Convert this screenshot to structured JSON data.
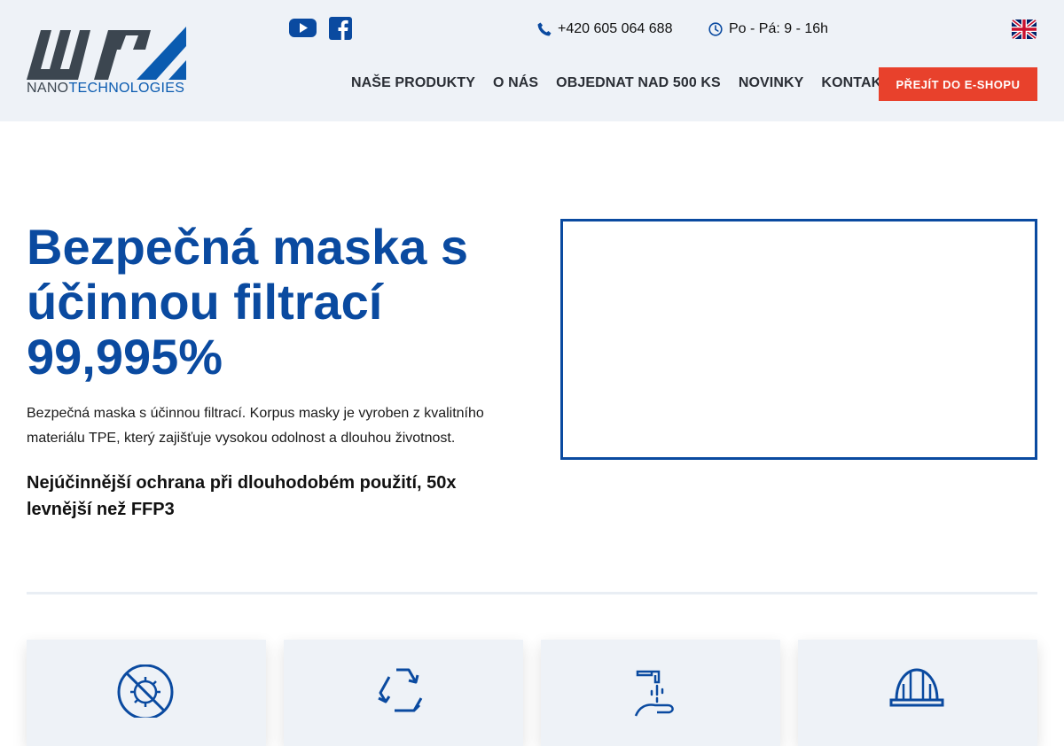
{
  "header": {
    "logo_word_left": "NANO",
    "logo_word_right": "TECHNOLOGIES",
    "phone": "+420 605 064 688",
    "hours": "Po - Pá: 9 - 16h",
    "nav": [
      "NAŠE PRODUKTY",
      "O NÁS",
      "OBJEDNAT NAD 500 KS",
      "NOVINKY",
      "KONTAKTY"
    ],
    "shop_button": "PŘEJÍT DO E-SHOPU"
  },
  "hero": {
    "title": "Bezpečná maska s účinnou filtrací 99,995%",
    "description": "Bezpečná maska s účinnou filtrací. Korpus masky je vyroben z kvalitního materiálu TPE, který zajišťuje vysokou odolnost a dlouhou životnost.",
    "highlight": "Nejúčinnější ochrana při dlouhodobém použití, 50x levnější než FFP3"
  },
  "colors": {
    "primary": "#0a4aa0",
    "accent": "#e8412c",
    "header_bg": "#eef2f7"
  },
  "icons": [
    "youtube-icon",
    "facebook-icon",
    "phone-icon",
    "clock-icon",
    "uk-flag-icon",
    "no-virus-icon",
    "recycle-icon",
    "hand-wash-icon",
    "hard-hat-icon"
  ]
}
